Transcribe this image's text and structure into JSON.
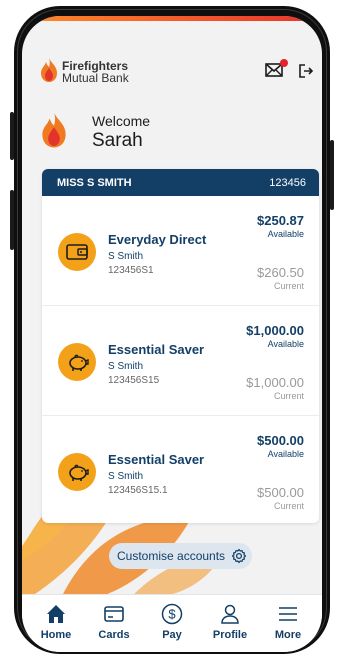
{
  "bank": {
    "name_line1": "Firefighters",
    "name_line2": "Mutual Bank"
  },
  "welcome": {
    "label": "Welcome",
    "name": "Sarah"
  },
  "owner": {
    "name": "MISS S SMITH",
    "number": "123456"
  },
  "accounts": [
    {
      "title": "Everyday Direct",
      "holder": "S Smith",
      "number": "123456S1",
      "available": "$250.87",
      "available_label": "Available",
      "current": "$260.50",
      "current_label": "Current",
      "icon": "wallet-icon"
    },
    {
      "title": "Essential Saver",
      "holder": "S Smith",
      "number": "123456S15",
      "available": "$1,000.00",
      "available_label": "Available",
      "current": "$1,000.00",
      "current_label": "Current",
      "icon": "piggy-bank-icon"
    },
    {
      "title": "Essential Saver",
      "holder": "S Smith",
      "number": "123456S15.1",
      "available": "$500.00",
      "available_label": "Available",
      "current": "$500.00",
      "current_label": "Current",
      "icon": "piggy-bank-icon"
    }
  ],
  "customise": {
    "label": "Customise accounts",
    "icon": "gear-icon"
  },
  "nav": [
    {
      "label": "Home",
      "icon": "home-icon"
    },
    {
      "label": "Cards",
      "icon": "card-icon"
    },
    {
      "label": "Pay",
      "icon": "dollar-icon"
    },
    {
      "label": "Profile",
      "icon": "profile-icon"
    },
    {
      "label": "More",
      "icon": "menu-icon"
    }
  ],
  "colors": {
    "navy": "#133f67",
    "accent": "#f4a11a",
    "alert": "#e52328"
  }
}
